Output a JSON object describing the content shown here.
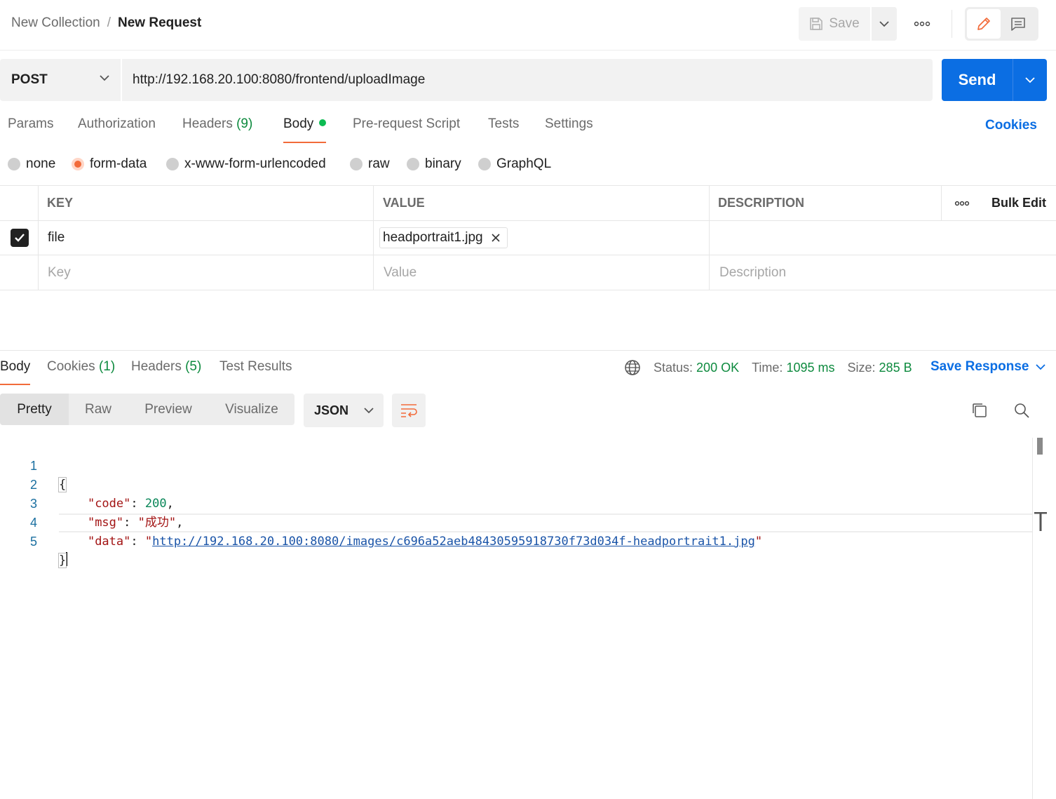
{
  "header": {
    "collection": "New Collection",
    "separator": "/",
    "request_name": "New Request",
    "save_label": "Save"
  },
  "request": {
    "method": "POST",
    "url": "http://192.168.20.100:8080/frontend/uploadImage",
    "send_label": "Send"
  },
  "tabs": {
    "params": "Params",
    "authorization": "Authorization",
    "headers": "Headers",
    "headers_count": "(9)",
    "body": "Body",
    "prerequest": "Pre-request Script",
    "tests": "Tests",
    "settings": "Settings",
    "cookies": "Cookies"
  },
  "body_types": {
    "none": "none",
    "form_data": "form-data",
    "urlencoded": "x-www-form-urlencoded",
    "raw": "raw",
    "binary": "binary",
    "graphql": "GraphQL",
    "selected": "form-data"
  },
  "table": {
    "headers": {
      "key": "KEY",
      "value": "VALUE",
      "description": "DESCRIPTION",
      "bulk_edit": "Bulk Edit"
    },
    "rows": [
      {
        "checked": true,
        "key": "file",
        "value": "headportrait1.jpg",
        "description": ""
      }
    ],
    "placeholders": {
      "key": "Key",
      "value": "Value",
      "description": "Description"
    }
  },
  "response": {
    "tabs": {
      "body": "Body",
      "cookies": "Cookies",
      "cookies_count": "(1)",
      "headers": "Headers",
      "headers_count": "(5)",
      "test_results": "Test Results"
    },
    "status_label": "Status:",
    "status": "200 OK",
    "time_label": "Time:",
    "time": "1095 ms",
    "size_label": "Size:",
    "size": "285 B",
    "save_response": "Save Response",
    "views": {
      "pretty": "Pretty",
      "raw": "Raw",
      "preview": "Preview",
      "visualize": "Visualize"
    },
    "format": "JSON",
    "code": {
      "line_numbers": [
        "1",
        "2",
        "3",
        "4",
        "5"
      ],
      "open_brace": "{",
      "close_brace": "}",
      "code_key": "\"code\"",
      "code_value": "200",
      "msg_key": "\"msg\"",
      "msg_value": "\"成功\"",
      "data_key": "\"data\"",
      "data_value": "http://192.168.20.100:8080/images/c696a52aeb48430595918730f73d034f-headportrait1.jpg"
    }
  },
  "colors": {
    "accent_orange": "#f26b3a",
    "send_blue": "#0b6ee3",
    "status_green": "#0d8a3e"
  }
}
